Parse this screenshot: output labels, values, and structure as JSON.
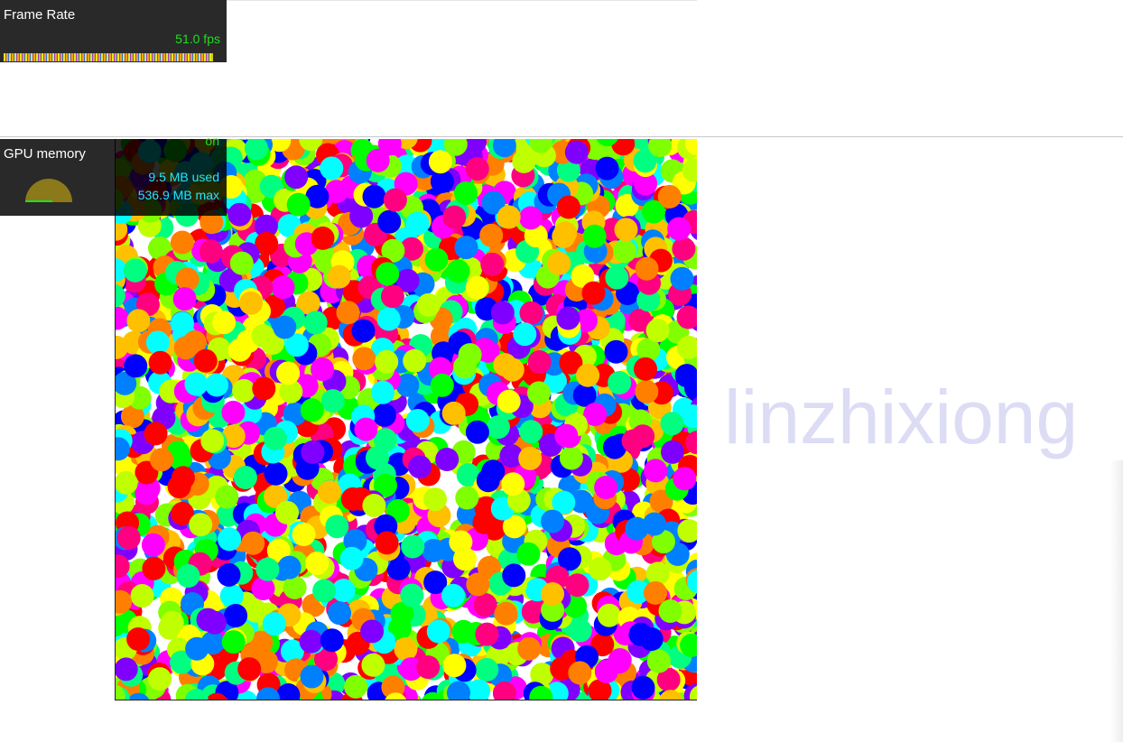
{
  "fps_meter": {
    "title": "Frame Rate",
    "value_text": "51.0 fps"
  },
  "gpu_meter": {
    "title": "GPU memory",
    "status_text": "on",
    "used_text": "9.5 MB used",
    "max_text": "536.9 MB max"
  },
  "watermark": {
    "text": "linzhixiong"
  },
  "particle_canvas": {
    "palette": [
      "#ff0000",
      "#00ff00",
      "#0000ff",
      "#ffff00",
      "#ff00ff",
      "#00ffff",
      "#ff8000",
      "#80ff00",
      "#8000ff",
      "#ff0080",
      "#00ff80",
      "#0080ff",
      "#ffc000",
      "#c0ff00"
    ]
  }
}
